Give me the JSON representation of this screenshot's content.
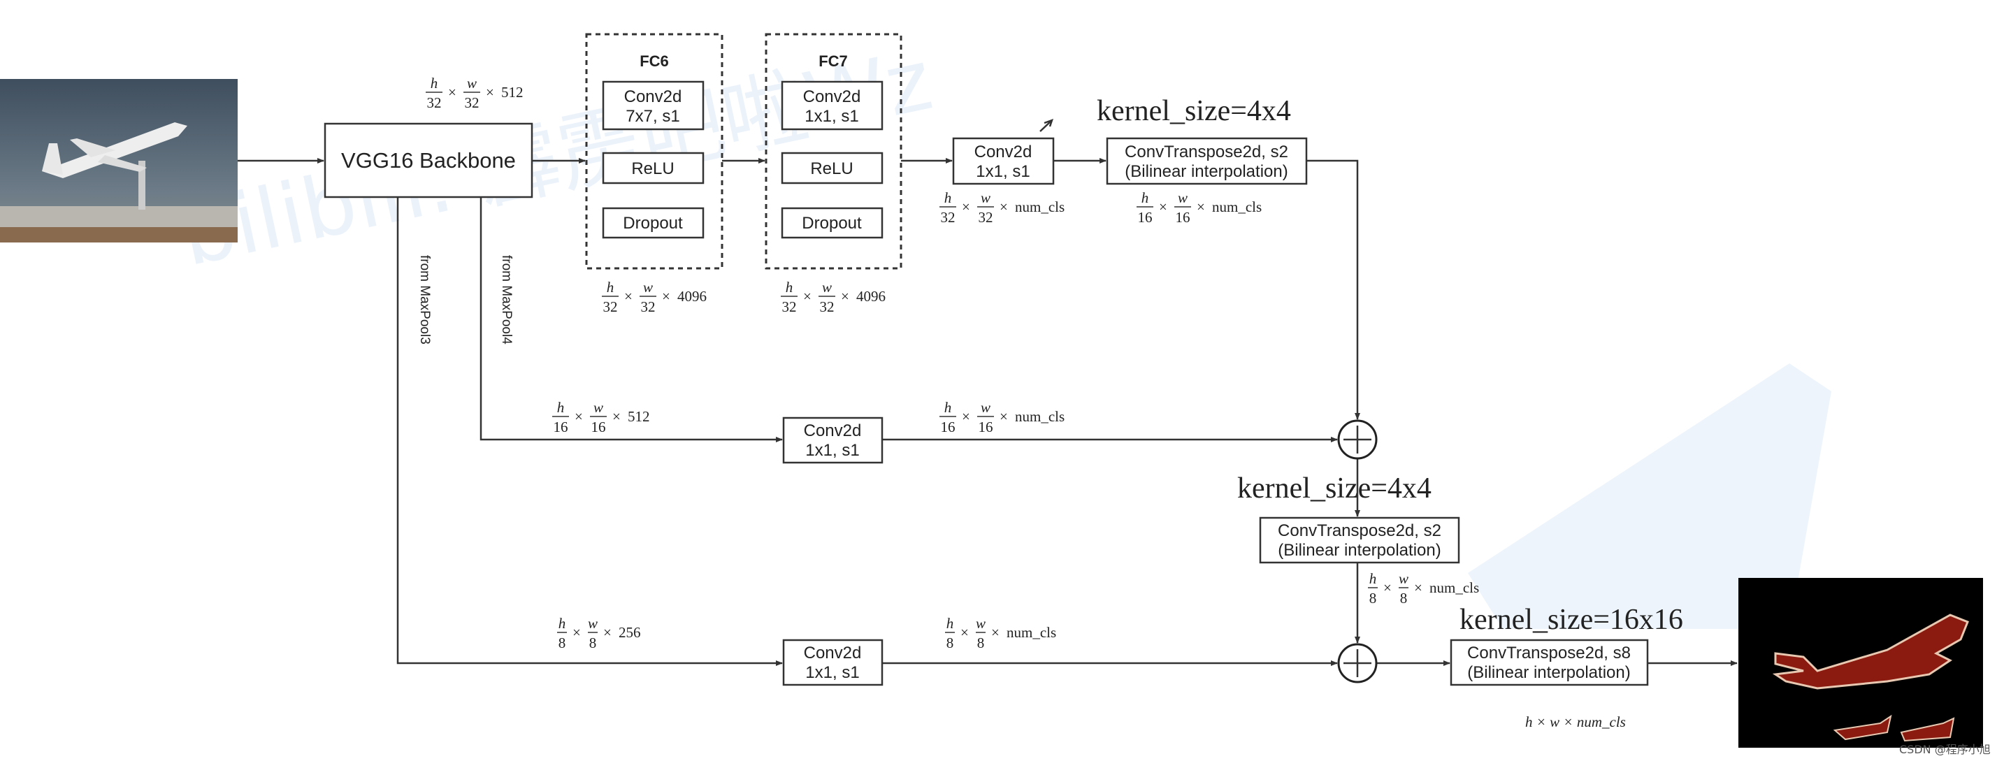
{
  "watermark": "bilibili: 霹雳吧啦Wz",
  "credit": "CSDN @程序小旭",
  "backbone": "VGG16 Backbone",
  "fc6": {
    "title": "FC6",
    "conv_l1": "Conv2d",
    "conv_l2": "7x7, s1",
    "relu": "ReLU",
    "dropout": "Dropout"
  },
  "fc7": {
    "title": "FC7",
    "conv_l1": "Conv2d",
    "conv_l2": "1x1, s1",
    "relu": "ReLU",
    "dropout": "Dropout"
  },
  "conv_score32": {
    "l1": "Conv2d",
    "l2": "1x1, s1"
  },
  "conv_score16": {
    "l1": "Conv2d",
    "l2": "1x1, s1"
  },
  "conv_score8": {
    "l1": "Conv2d",
    "l2": "1x1, s1"
  },
  "upsample1": {
    "l1": "ConvTranspose2d, s2",
    "l2": "(Bilinear interpolation)",
    "kernel": "kernel_size=4x4"
  },
  "upsample2": {
    "l1": "ConvTranspose2d, s2",
    "l2": "(Bilinear interpolation)",
    "kernel": "kernel_size=4x4"
  },
  "upsample3": {
    "l1": "ConvTranspose2d, s8",
    "l2": "(Bilinear interpolation)",
    "kernel": "kernel_size=16x16"
  },
  "branches": {
    "pool4": "from MaxPool4",
    "pool3": "from MaxPool3"
  },
  "annotations": [
    {
      "id": "backbone-out",
      "h": "32",
      "w": "32",
      "c": "512"
    },
    {
      "id": "fc6-out",
      "h": "32",
      "w": "32",
      "c": "4096"
    },
    {
      "id": "fc7-out",
      "h": "32",
      "w": "32",
      "c": "4096"
    },
    {
      "id": "score32-out",
      "h": "32",
      "w": "32",
      "c": "num_cls"
    },
    {
      "id": "up1-out",
      "h": "16",
      "w": "16",
      "c": "num_cls"
    },
    {
      "id": "pool4-in",
      "h": "16",
      "w": "16",
      "c": "512"
    },
    {
      "id": "score16-out",
      "h": "16",
      "w": "16",
      "c": "num_cls"
    },
    {
      "id": "up2-out",
      "h": "8",
      "w": "8",
      "c": "num_cls"
    },
    {
      "id": "pool3-in",
      "h": "8",
      "w": "8",
      "c": "256"
    },
    {
      "id": "score8-out",
      "h": "8",
      "w": "8",
      "c": "num_cls"
    }
  ],
  "final_shape": "h × w × num_cls",
  "colors": {
    "line": "#333333",
    "mask": "#8b1a10",
    "mask_edge": "#e8c8b0",
    "watermark": "#dbe9f7"
  }
}
